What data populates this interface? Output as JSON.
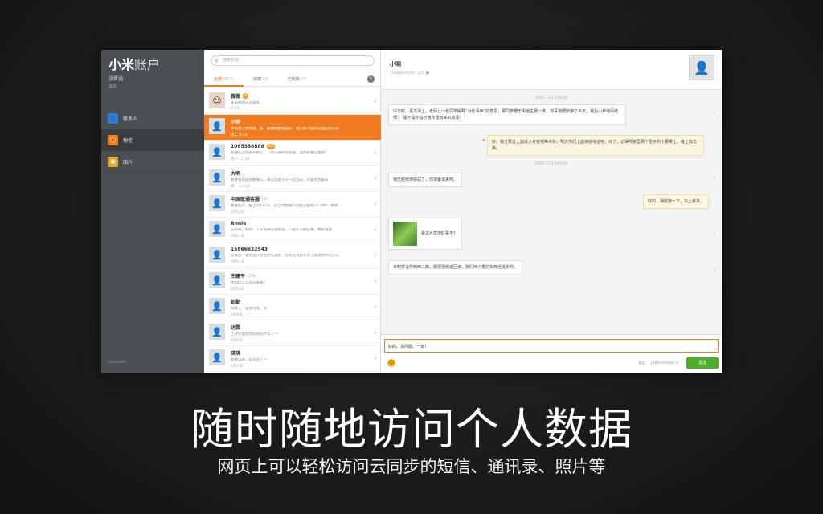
{
  "sidebar": {
    "brand": "小米",
    "brand_sub": "账户",
    "user_name": "张晋涵",
    "user_sub": "退出",
    "items": [
      {
        "label": "联系人",
        "icon": "contacts-icon",
        "color": "#2f7fd1"
      },
      {
        "label": "短信",
        "icon": "sms-icon",
        "color": "#f07b20"
      },
      {
        "label": "图片",
        "icon": "photos-icon",
        "color": "#e7a52a"
      }
    ],
    "footer": "miui.com"
  },
  "list": {
    "search_placeholder": "搜索短信",
    "tabs": [
      {
        "label": "全部",
        "count": "(877)"
      },
      {
        "label": "收藏",
        "count": "(2)"
      },
      {
        "label": "已删除",
        "count": "(7)"
      }
    ],
    "rows": [
      {
        "name": "薇薇",
        "badge": "3",
        "preview": "早安啊明天见面啦",
        "time": "8:24"
      },
      {
        "name": "小明",
        "badge": "",
        "preview": "幸制禁让你到西二旗，顺便把她送回家，我们两个量的东西还挺多的",
        "time": "周二 8:24"
      },
      {
        "name": "1065588888",
        "badge": "12",
        "preview": "新通信业务就开始了，二月开通的有惊喜，当月套餐已生效",
        "time": "周一 11:24"
      },
      {
        "name": "大明",
        "badge": "",
        "preview": "哪楼有我说你那事儿，现在帮我小子一起出去，大家的大家的",
        "time": "周一 14:34"
      },
      {
        "name": "中国联通客服",
        "badge": "",
        "count": "(5)",
        "preview": "尊敬客户，截止2月15日，您当月套餐内流量已使用70.38M，剩余...",
        "time": "3月12日"
      },
      {
        "name": "Annie",
        "badge": "",
        "preview": "记得啊，好吧，下次别来记错地址，一起学习那些事，我好准备",
        "time": "3月11日"
      },
      {
        "name": "15866632543",
        "badge": "",
        "preview": "您满意一箱太累分享给你们满屋，您有机会获得手工都需要你的大礼",
        "time": "3月11日"
      },
      {
        "name": "王建平",
        "badge": "",
        "count": "(14)",
        "preview": "你电信怎么还没来啊？",
        "time": "3月10日"
      },
      {
        "name": "彭勤",
        "badge": "",
        "preview": "啊啊，一定要叫啊，要",
        "time": "3月9日"
      },
      {
        "name": "达霖",
        "badge": "",
        "preview": "上次打电话你说你说什么了～",
        "time": "3月8日"
      },
      {
        "name": "琪琪",
        "badge": "",
        "preview": "都要自来，电话过了～",
        "time": "3月7日"
      }
    ]
  },
  "chat": {
    "name": "小明",
    "phone": "15894609392",
    "phone_tag": "北京",
    "stamp1": "2015-11-13 09:30",
    "stamp2": "2015-11-13 09:30",
    "messages": [
      {
        "from": "them",
        "text": "中华时，语文课上，老师让一名同学解释“对比事声”的意思，那同学愣于街道生那一类，抓耳挠腮酝酿了半天，最后小声地问老师：“是不是你指示南所望出来的意思？”"
      },
      {
        "from": "me",
        "text": "好，我主要去上面体大考究视等点科，明天你们上面将给电话吧，对了，记得明家里那个柜子的小要带上，晚上找去换。"
      },
      {
        "from": "them",
        "text": "我已经到地铁站了，你准备出来吧。"
      },
      {
        "from": "me",
        "text": "好的，我收拾一下，马上就来。"
      },
      {
        "from": "them",
        "text": "看这片草地好看不？",
        "image": true
      },
      {
        "from": "them",
        "text": "幸制禁让你到西二旗，顺便把她送回家，我们两个量的东西还挺多的。"
      }
    ],
    "draft": "好的。没问题。一定！",
    "sender_label": "发自：",
    "sender_number": "15894609392",
    "send_label": "发送"
  },
  "headline": "随时随地访问个人数据",
  "subline": "网页上可以轻松访问云同步的短信、通讯录、照片等"
}
